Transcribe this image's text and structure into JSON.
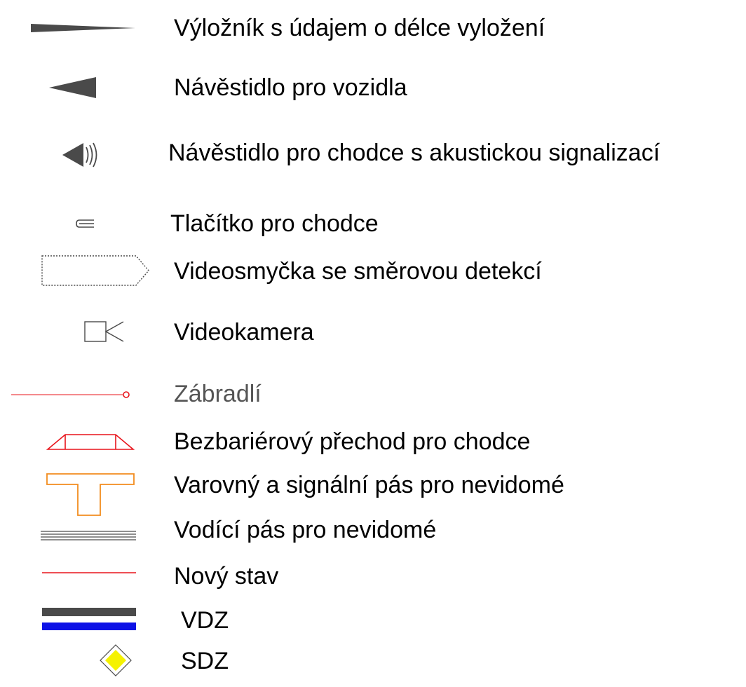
{
  "legend": {
    "items": [
      {
        "label": "Výložník s údajem o délce vyložení",
        "icon": "boom-arm-wedge-icon"
      },
      {
        "label": "Návěstidlo pro vozidla",
        "icon": "vehicle-signal-triangle-icon"
      },
      {
        "label": "Návěstidlo pro chodce s akustickou signalizací",
        "icon": "pedestrian-signal-acoustic-icon"
      },
      {
        "label": "Tlačítko pro chodce",
        "icon": "pedestrian-button-icon"
      },
      {
        "label": "Videosmyčka se směrovou detekcí",
        "icon": "video-loop-directional-icon"
      },
      {
        "label": "Videokamera",
        "icon": "video-camera-icon"
      },
      {
        "label": "Zábradlí",
        "icon": "railing-line-icon",
        "color": "#555555"
      },
      {
        "label": "Bezbariérový přechod pro chodce",
        "icon": "barrier-free-crossing-icon",
        "color": "#e8141b"
      },
      {
        "label": "Varovný a signální pás pro nevidomé",
        "icon": "warning-strip-t-icon",
        "color": "#f28c1e"
      },
      {
        "label": "Vodící pás pro nevidomé",
        "icon": "guide-strip-lines-icon"
      },
      {
        "label": "Nový stav",
        "icon": "new-state-red-line-icon",
        "color": "#e8141b"
      },
      {
        "label": "VDZ",
        "icon": "vdz-marking-icon",
        "color": "#0d12e6"
      },
      {
        "label": "SDZ",
        "icon": "sdz-priority-diamond-icon",
        "color": "#f5f200"
      }
    ]
  }
}
